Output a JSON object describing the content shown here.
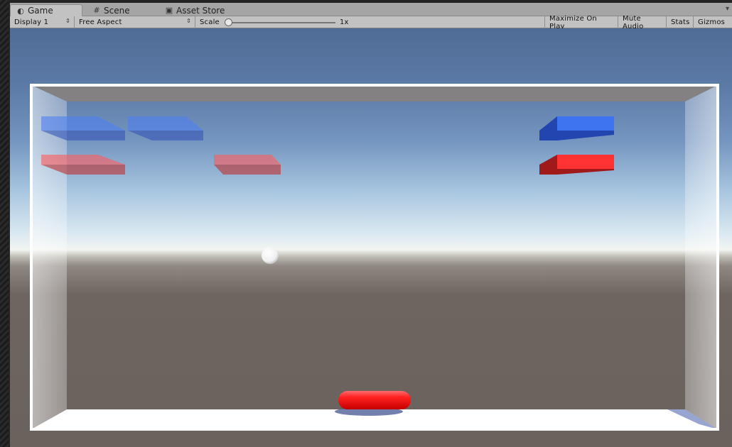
{
  "tabs": [
    {
      "label": "Game",
      "icon": "game-icon",
      "active": true
    },
    {
      "label": "Scene",
      "icon": "scene-grid-icon",
      "active": false
    },
    {
      "label": "Asset Store",
      "icon": "asset-store-icon",
      "active": false
    }
  ],
  "toolbar": {
    "display": "Display 1",
    "aspect": "Free Aspect",
    "scale_label": "Scale",
    "scale_value": "1x",
    "maximize_on_play": "Maximize On Play",
    "mute_audio": "Mute Audio",
    "stats": "Stats",
    "gizmos": "Gizmos"
  },
  "scene": {
    "colors": {
      "blue_brick": "#3f6fe0",
      "red_brick": "#ff3a3a",
      "paddle": "#ff2020",
      "ball": "#ffffff",
      "frame": "#ffffff"
    },
    "bricks": [
      {
        "name": "brick-blue-1",
        "color": "blue",
        "faded": true
      },
      {
        "name": "brick-blue-2",
        "color": "blue",
        "faded": true
      },
      {
        "name": "brick-blue-3",
        "color": "blue",
        "faded": false
      },
      {
        "name": "brick-red-1",
        "color": "red",
        "faded": true
      },
      {
        "name": "brick-red-2",
        "color": "red",
        "faded": true
      },
      {
        "name": "brick-red-3",
        "color": "red",
        "faded": false
      }
    ]
  }
}
